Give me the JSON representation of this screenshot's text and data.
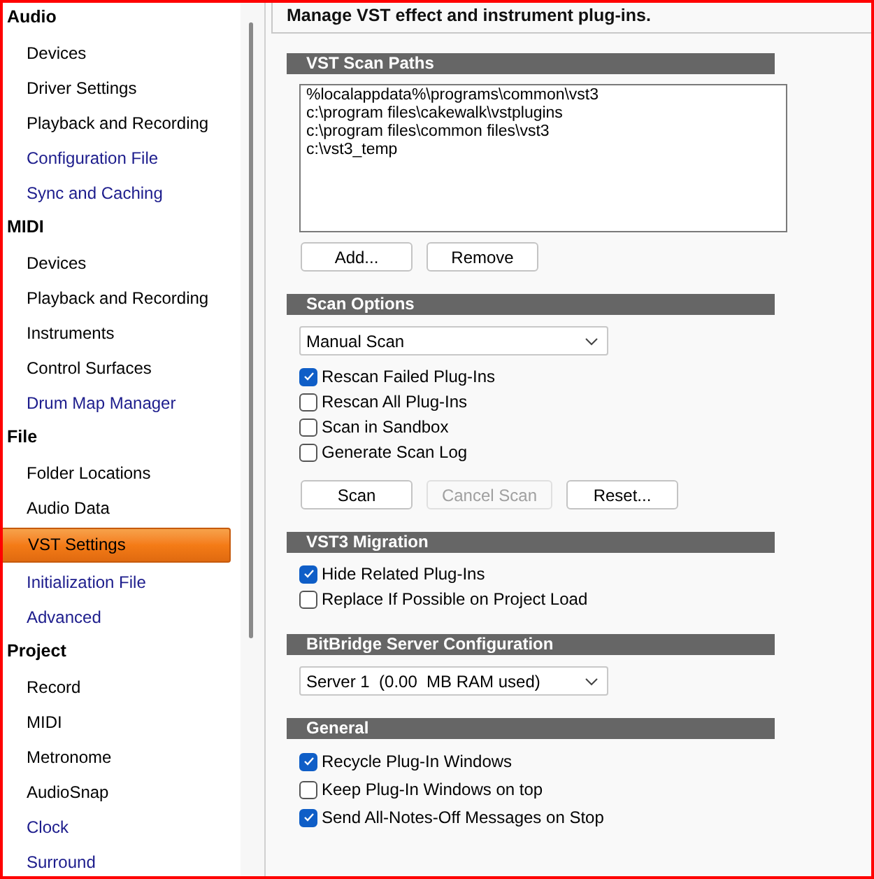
{
  "sidebar": {
    "groups": [
      {
        "label": "Audio",
        "items": [
          {
            "label": "Devices",
            "selected": false,
            "visited": false
          },
          {
            "label": "Driver Settings",
            "selected": false,
            "visited": false
          },
          {
            "label": "Playback and Recording",
            "selected": false,
            "visited": false
          },
          {
            "label": "Configuration File",
            "selected": false,
            "visited": true
          },
          {
            "label": "Sync and Caching",
            "selected": false,
            "visited": true
          }
        ]
      },
      {
        "label": "MIDI",
        "items": [
          {
            "label": "Devices",
            "selected": false,
            "visited": false
          },
          {
            "label": "Playback and Recording",
            "selected": false,
            "visited": false
          },
          {
            "label": "Instruments",
            "selected": false,
            "visited": false
          },
          {
            "label": "Control Surfaces",
            "selected": false,
            "visited": false
          },
          {
            "label": "Drum Map Manager",
            "selected": false,
            "visited": true
          }
        ]
      },
      {
        "label": "File",
        "items": [
          {
            "label": "Folder Locations",
            "selected": false,
            "visited": false
          },
          {
            "label": "Audio Data",
            "selected": false,
            "visited": false
          },
          {
            "label": "VST Settings",
            "selected": true,
            "visited": false
          },
          {
            "label": "Initialization File",
            "selected": false,
            "visited": true
          },
          {
            "label": "Advanced",
            "selected": false,
            "visited": true
          }
        ]
      },
      {
        "label": "Project",
        "items": [
          {
            "label": "Record",
            "selected": false,
            "visited": false
          },
          {
            "label": "MIDI",
            "selected": false,
            "visited": false
          },
          {
            "label": "Metronome",
            "selected": false,
            "visited": false
          },
          {
            "label": "AudioSnap",
            "selected": false,
            "visited": false
          },
          {
            "label": "Clock",
            "selected": false,
            "visited": true
          },
          {
            "label": "Surround",
            "selected": false,
            "visited": true
          }
        ]
      }
    ]
  },
  "panel": {
    "description": "Manage VST effect and instrument plug-ins.",
    "sections": [
      {
        "title": "VST Scan Paths",
        "controls": [
          {
            "kind": "listbox",
            "items": [
              "%localappdata%\\programs\\common\\vst3",
              "c:\\program files\\cakewalk\\vstplugins",
              "c:\\program files\\common files\\vst3",
              "c:\\vst3_temp"
            ]
          },
          {
            "kind": "buttons",
            "buttons": [
              {
                "label": "Add...",
                "disabled": false
              },
              {
                "label": "Remove",
                "disabled": false
              }
            ]
          }
        ]
      },
      {
        "title": "Scan Options",
        "controls": [
          {
            "kind": "dropdown",
            "value": "Manual Scan"
          },
          {
            "kind": "checkbox",
            "label": "Rescan Failed Plug-Ins",
            "checked": true
          },
          {
            "kind": "checkbox",
            "label": "Rescan All Plug-Ins",
            "checked": false
          },
          {
            "kind": "checkbox",
            "label": "Scan in Sandbox",
            "checked": false
          },
          {
            "kind": "checkbox",
            "label": "Generate Scan Log",
            "checked": false
          },
          {
            "kind": "buttons",
            "buttons": [
              {
                "label": "Scan",
                "disabled": false
              },
              {
                "label": "Cancel Scan",
                "disabled": true
              },
              {
                "label": "Reset...",
                "disabled": false
              }
            ]
          }
        ]
      },
      {
        "title": "VST3 Migration",
        "controls": [
          {
            "kind": "checkbox",
            "label": "Hide Related Plug-Ins",
            "checked": true
          },
          {
            "kind": "checkbox",
            "label": "Replace If Possible on Project Load",
            "checked": false
          }
        ]
      },
      {
        "title": "BitBridge Server Configuration",
        "controls": [
          {
            "kind": "dropdown",
            "value": "Server 1  (0.00  MB RAM used)"
          }
        ]
      },
      {
        "title": "General",
        "controls": [
          {
            "kind": "checkbox",
            "label": "Recycle Plug-In Windows",
            "checked": true
          },
          {
            "kind": "checkbox",
            "label": "Keep Plug-In Windows on top",
            "checked": false
          },
          {
            "kind": "checkbox",
            "label": "Send All-Notes-Off Messages on Stop",
            "checked": true
          }
        ]
      }
    ]
  }
}
